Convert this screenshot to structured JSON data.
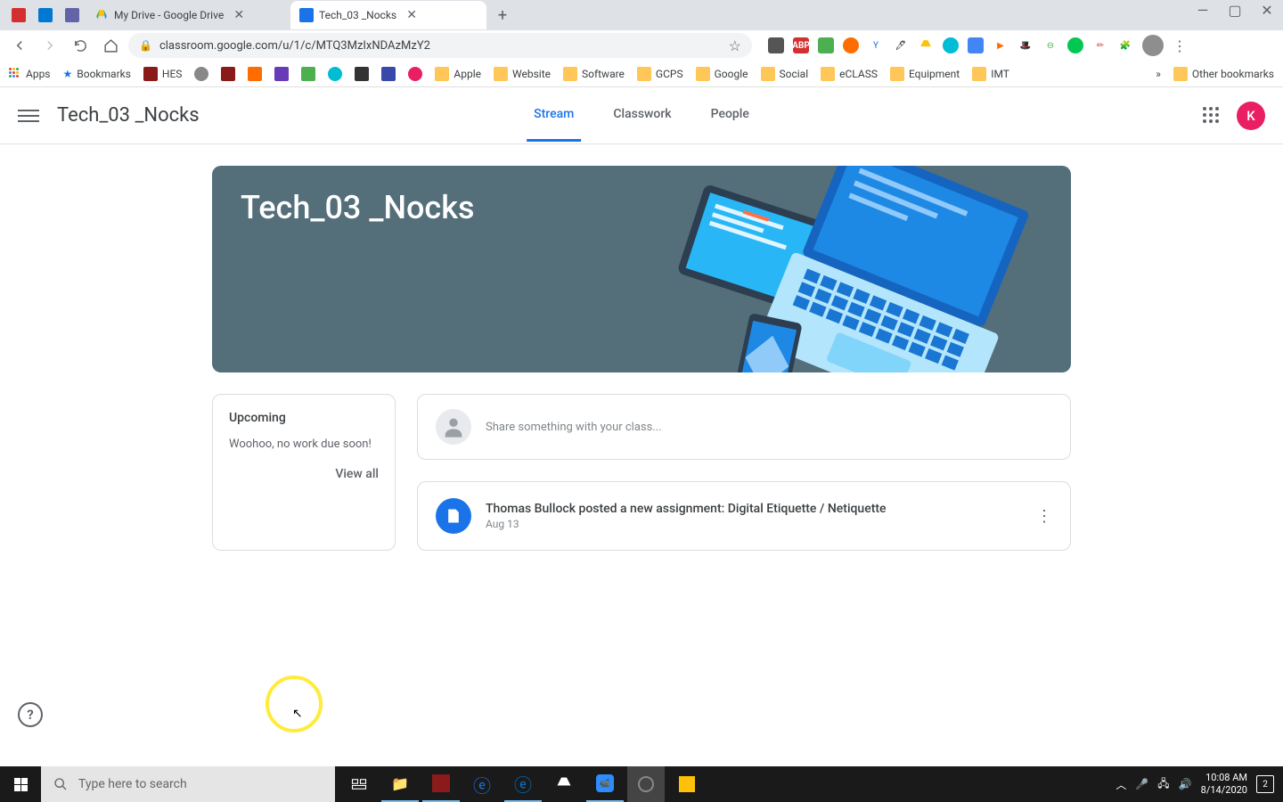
{
  "browser": {
    "tabs": [
      {
        "label": "My Drive - Google Drive"
      },
      {
        "label": "Tech_03 _Nocks"
      }
    ],
    "url": "classroom.google.com/u/1/c/MTQ3MzIxNDAzMzY2",
    "bookmarks": [
      "Apps",
      "Bookmarks",
      "HES",
      "",
      "",
      "",
      "",
      "",
      "",
      "",
      "Apple",
      "Website",
      "Software",
      "GCPS",
      "Google",
      "Social",
      "eCLASS",
      "Equipment",
      "IMT"
    ],
    "other_bookmarks": "Other bookmarks"
  },
  "header": {
    "title": "Tech_03 _Nocks",
    "tabs": {
      "stream": "Stream",
      "classwork": "Classwork",
      "people": "People"
    },
    "avatar_initial": "K"
  },
  "hero": {
    "title": "Tech_03 _Nocks"
  },
  "upcoming": {
    "title": "Upcoming",
    "message": "Woohoo, no work due soon!",
    "view_all": "View all"
  },
  "share": {
    "placeholder": "Share something with your class..."
  },
  "post": {
    "title": "Thomas Bullock posted a new assignment: Digital Etiquette / Netiquette",
    "date": "Aug 13"
  },
  "taskbar": {
    "search_placeholder": "Type here to search",
    "time": "10:08 AM",
    "date": "8/14/2020",
    "notif_count": "2"
  }
}
